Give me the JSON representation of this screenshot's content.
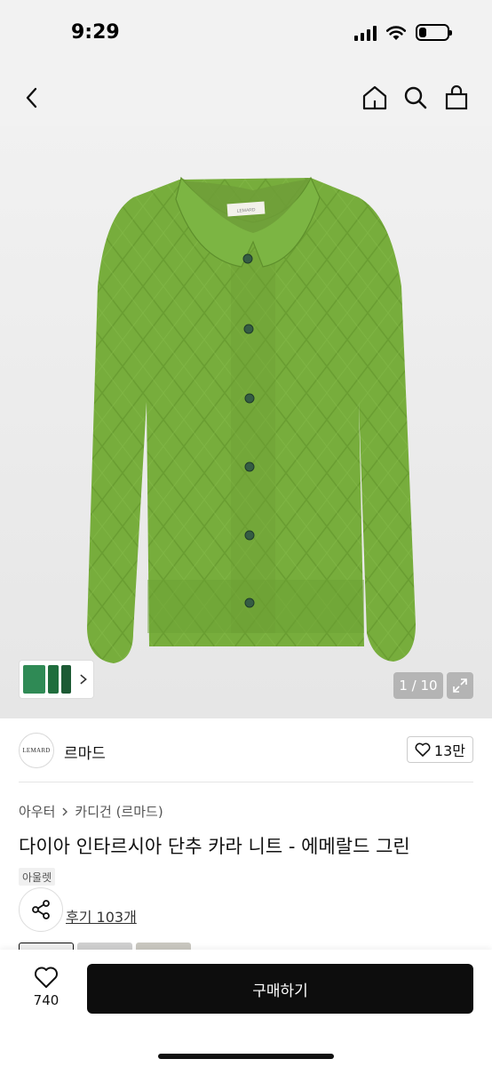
{
  "status": {
    "time": "9:29",
    "battery_level": 0.25
  },
  "nav": {
    "icons": [
      "back-icon",
      "home-icon",
      "search-icon",
      "shopping-bag-icon"
    ]
  },
  "image": {
    "counter": "1 / 10",
    "label_tag": "LEMARD",
    "colors": {
      "knit": "#77ad3c",
      "thumb_1": "#2f8a55",
      "thumb_2": "#1f6e3d",
      "thumb_3": "#1c5a34"
    }
  },
  "brand": {
    "logo_text": "LEMARD",
    "name": "르마드",
    "likes": "13만"
  },
  "breadcrumb": {
    "category": "아우터",
    "subcategory": "카디건 (르마드)"
  },
  "product": {
    "title": "다이아 인타르시아 단추 카라 니트 - 에메랄드 그린",
    "badge": "아울렛",
    "reviews": "후기 103개"
  },
  "bottom_bar": {
    "wish_count": "740",
    "buy_label": "구매하기"
  }
}
